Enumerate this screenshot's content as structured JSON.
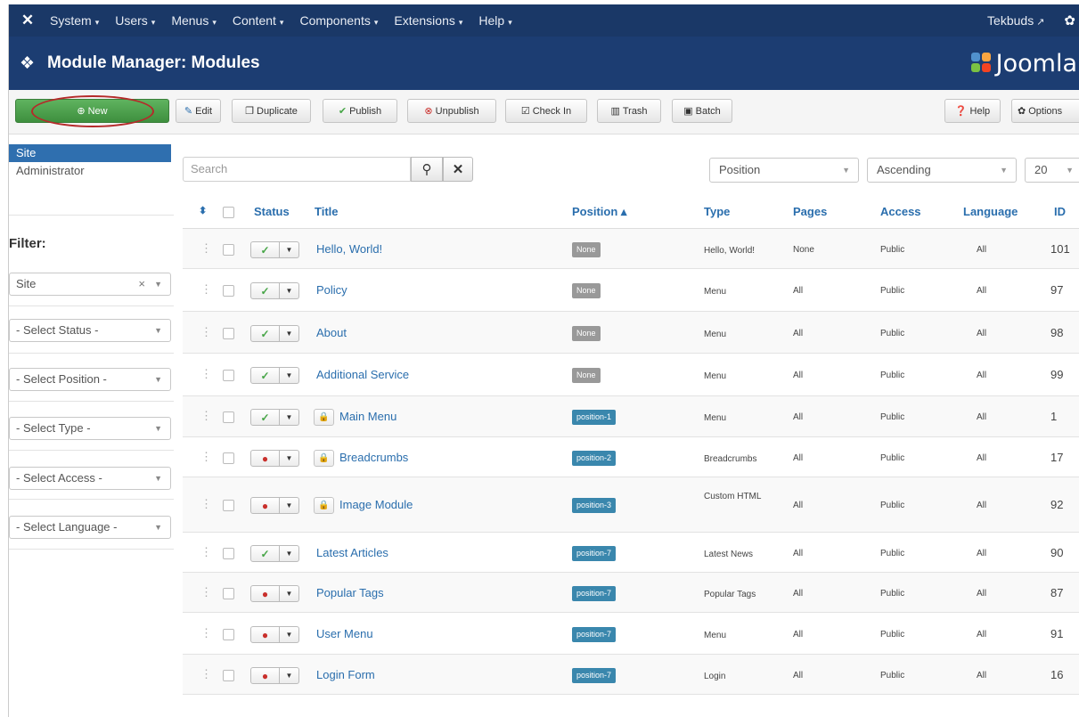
{
  "topnav": {
    "logo_icon": "joomla-x-icon",
    "menus": [
      "System",
      "Users",
      "Menus",
      "Content",
      "Components",
      "Extensions",
      "Help"
    ],
    "caret": "▾",
    "user": "Tekbuds",
    "user_icon": "external-link-icon",
    "settings_icon": "gear-icon"
  },
  "header": {
    "title": "Module Manager: Modules",
    "brand": "Joomla"
  },
  "toolbar": {
    "new": "New",
    "edit": "Edit",
    "duplicate": "Duplicate",
    "publish": "Publish",
    "unpublish": "Unpublish",
    "checkin": "Check In",
    "trash": "Trash",
    "batch": "Batch",
    "help": "Help",
    "options": "Options"
  },
  "sidebar": {
    "site": "Site",
    "administrator": "Administrator",
    "filter_label": "Filter:",
    "filters": [
      "Site",
      "- Select Status -",
      "- Select Position -",
      "- Select Type -",
      "- Select Access -",
      "- Select Language -"
    ]
  },
  "search": {
    "placeholder": "Search"
  },
  "list_controls": {
    "order_by": "Position",
    "direction": "Ascending",
    "limit": "20"
  },
  "table": {
    "headers": {
      "status": "Status",
      "title": "Title",
      "position": "Position ▴",
      "type": "Type",
      "pages": "Pages",
      "access": "Access",
      "language": "Language",
      "id": "ID"
    },
    "rows": [
      {
        "status": "published",
        "locked": false,
        "title": "Hello, World!",
        "position": "None",
        "type": "Hello, World!",
        "pages": "None",
        "access": "Public",
        "language": "All",
        "id": "101"
      },
      {
        "status": "published",
        "locked": false,
        "title": "Policy",
        "position": "None",
        "type": "Menu",
        "pages": "All",
        "access": "Public",
        "language": "All",
        "id": "97"
      },
      {
        "status": "published",
        "locked": false,
        "title": "About",
        "position": "None",
        "type": "Menu",
        "pages": "All",
        "access": "Public",
        "language": "All",
        "id": "98"
      },
      {
        "status": "published",
        "locked": false,
        "title": "Additional Service",
        "position": "None",
        "type": "Menu",
        "pages": "All",
        "access": "Public",
        "language": "All",
        "id": "99"
      },
      {
        "status": "published",
        "locked": true,
        "title": "Main Menu",
        "position": "position-1",
        "type": "Menu",
        "pages": "All",
        "access": "Public",
        "language": "All",
        "id": "1"
      },
      {
        "status": "unpublished",
        "locked": true,
        "title": "Breadcrumbs",
        "position": "position-2",
        "type": "Breadcrumbs",
        "pages": "All",
        "access": "Public",
        "language": "All",
        "id": "17"
      },
      {
        "status": "unpublished",
        "locked": true,
        "title": "Image Module",
        "position": "position-3",
        "type": "Custom HTML",
        "pages": "All",
        "access": "Public",
        "language": "All",
        "id": "92"
      },
      {
        "status": "published",
        "locked": false,
        "title": "Latest Articles",
        "position": "position-7",
        "type": "Latest News",
        "pages": "All",
        "access": "Public",
        "language": "All",
        "id": "90"
      },
      {
        "status": "unpublished",
        "locked": false,
        "title": "Popular Tags",
        "position": "position-7",
        "type": "Popular Tags",
        "pages": "All",
        "access": "Public",
        "language": "All",
        "id": "87"
      },
      {
        "status": "unpublished",
        "locked": false,
        "title": "User Menu",
        "position": "position-7",
        "type": "Menu",
        "pages": "All",
        "access": "Public",
        "language": "All",
        "id": "91"
      },
      {
        "status": "unpublished",
        "locked": false,
        "title": "Login Form",
        "position": "position-7",
        "type": "Login",
        "pages": "All",
        "access": "Public",
        "language": "All",
        "id": "16"
      }
    ]
  },
  "colors": {
    "nav_bg": "#1a3867",
    "header_bg": "#1c3d72",
    "new_button": "#46a546",
    "link": "#2a6ead",
    "position_badge": "#3a87ad",
    "none_badge": "#999999",
    "highlight_ring": "#b52a2a"
  }
}
